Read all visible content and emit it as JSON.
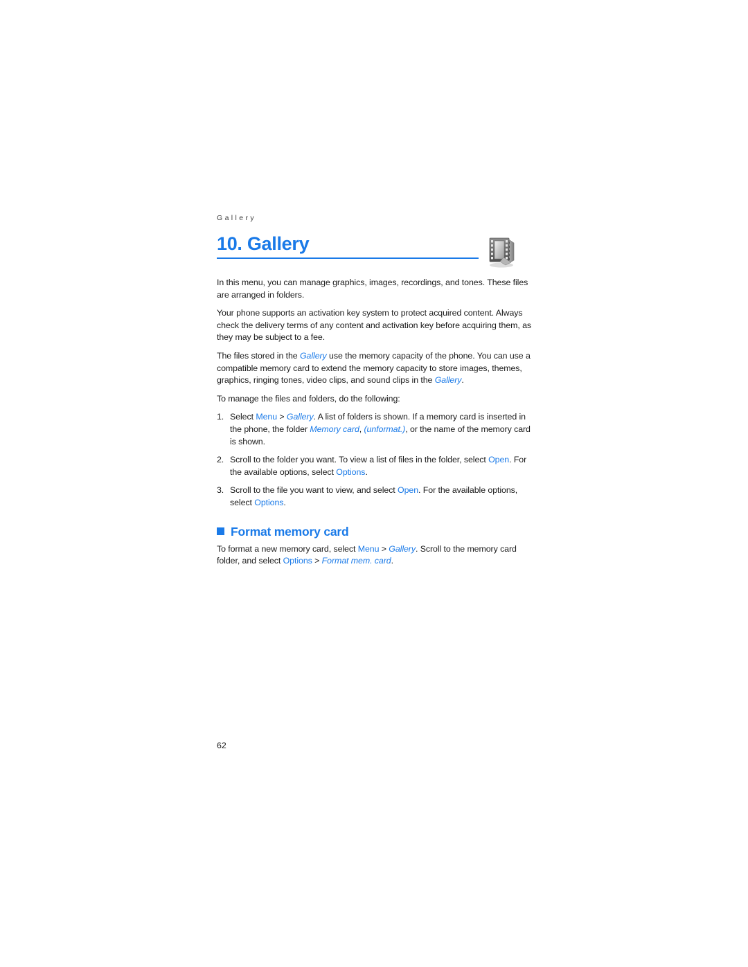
{
  "document": {
    "running_head": "Gallery",
    "page_number": "62",
    "accent_color": "#1a7ae8",
    "text_color": "#1a1a1a"
  },
  "chapter": {
    "title": "10. Gallery",
    "icon_name": "film-strip-icon"
  },
  "body": {
    "paragraph_1": "In this menu, you can manage graphics, images, recordings, and tones. These files are arranged in folders.",
    "paragraph_2": "Your phone supports an activation key system to protect acquired content. Always check the delivery terms of any content and activation key before acquiring them, as they may be subject to a fee.",
    "paragraph_3": {
      "part_1": "The files stored in the ",
      "term_1": "Gallery",
      "part_2": " use the memory capacity of the phone. You can use a compatible memory card to extend the memory capacity to store images, themes, graphics, ringing tones, video clips, and sound clips in the ",
      "term_2": "Gallery",
      "part_3": "."
    },
    "paragraph_4": "To manage the files and folders, do the following:"
  },
  "steps": [
    {
      "number": "1.",
      "part_1": "Select ",
      "ui_1": "Menu",
      "part_2": " > ",
      "term_1": "Gallery",
      "part_3": ". A list of folders is shown. If a memory card is inserted in the phone, the folder ",
      "term_2": "Memory card",
      "part_4": ", ",
      "term_3": "(unformat.)",
      "part_5": ", or the name of the memory card is shown."
    },
    {
      "number": "2.",
      "part_1": "Scroll to the folder you want. To view a list of files in the folder, select ",
      "ui_1": "Open",
      "part_2": ". For the available options, select ",
      "ui_2": "Options",
      "part_3": "."
    },
    {
      "number": "3.",
      "part_1": "Scroll to the file you want to view, and select ",
      "ui_1": "Open",
      "part_2": ". For the available options, select ",
      "ui_2": "Options",
      "part_3": "."
    }
  ],
  "section": {
    "heading": "Format memory card",
    "paragraph": {
      "part_1": "To format a new memory card, select ",
      "ui_1": "Menu",
      "part_2": " > ",
      "term_1": "Gallery",
      "part_3": ". Scroll to the memory card folder, and select ",
      "ui_2": "Options",
      "part_4": " > ",
      "term_2": "Format mem. card",
      "part_5": "."
    }
  }
}
